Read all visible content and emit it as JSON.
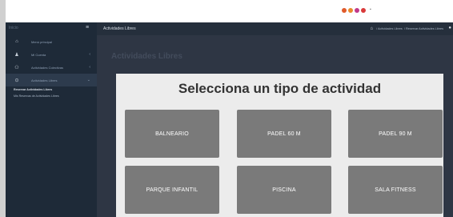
{
  "topbar": {
    "dot_label": "▪"
  },
  "sidebar": {
    "brand": "Inicio",
    "hamburger_icon": "≡",
    "items": [
      {
        "icon": "⌂",
        "label": "Menú principal",
        "chevron": ""
      },
      {
        "icon": "♟",
        "label": "Mi Cuenta",
        "chevron": "‹"
      },
      {
        "icon": "⚇",
        "label": "Actividades Colectivas",
        "chevron": "‹"
      },
      {
        "icon": "⊙",
        "label": "Actividades Libres",
        "chevron": "⌄"
      }
    ],
    "submenu": [
      {
        "label": "Reservar Actividades Libres"
      },
      {
        "label": "Mis Reservas de Actividades Libres"
      }
    ]
  },
  "header": {
    "title": "Actividades Libres",
    "home_icon": "⌂",
    "breadcrumb": [
      "/ Actividades Libres",
      "/ Reservar Actividades Libres"
    ],
    "end_icon": "●"
  },
  "content": {
    "page_title": "Actividades Libres",
    "card_title": "Selecciona un tipo de actividad",
    "activities": [
      {
        "label": "BALNEARIO"
      },
      {
        "label": "PADEL 60 M"
      },
      {
        "label": "PADEL 90 M"
      },
      {
        "label": "PARQUE INFANTIL"
      },
      {
        "label": "PISCINA"
      },
      {
        "label": "SALA FITNESS"
      }
    ]
  }
}
